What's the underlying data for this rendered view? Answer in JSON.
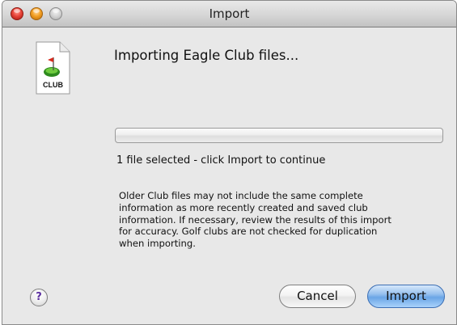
{
  "window": {
    "title": "Import"
  },
  "dialog": {
    "icon": "club-file-icon",
    "icon_label": "CLUB",
    "heading": "Importing Eagle Club files...",
    "progress_fraction": 0.0,
    "status": "1 file selected - click Import to continue",
    "note_lines": [
      "Older Club files may not include the same complete",
      "information as more recently created and saved club",
      "information.  If necessary, review the results of this import",
      "for accuracy.  Golf clubs are not checked for duplication",
      "when importing."
    ]
  },
  "buttons": {
    "help_symbol": "?",
    "cancel_label": "Cancel",
    "import_label": "Import"
  },
  "colors": {
    "default_button": "#6aa5e6",
    "help_glyph": "#5b2fa0"
  }
}
